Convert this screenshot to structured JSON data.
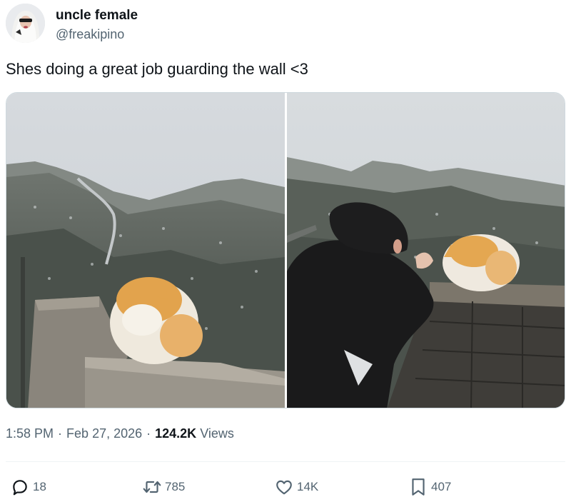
{
  "author": {
    "display_name": "uncle female",
    "handle": "@freakipino"
  },
  "tweet": {
    "text": "Shes doing a great job guarding the wall <3"
  },
  "media": {
    "photos": [
      {
        "icon": "photo-cat-on-wall"
      },
      {
        "icon": "photo-person-petting-cat"
      }
    ]
  },
  "meta": {
    "time": "1:58 PM",
    "separator": "·",
    "date": "Feb 27, 2026",
    "views_count": "124.2K",
    "views_label": "Views"
  },
  "actions": {
    "reply": {
      "count": "18",
      "icon": "reply-icon"
    },
    "retweet": {
      "count": "785",
      "icon": "retweet-icon"
    },
    "like": {
      "count": "14K",
      "icon": "heart-icon"
    },
    "bookmark": {
      "count": "407",
      "icon": "bookmark-icon"
    }
  },
  "colors": {
    "text_primary": "#0f1419",
    "text_secondary": "#536471",
    "border": "#cfd9de"
  }
}
